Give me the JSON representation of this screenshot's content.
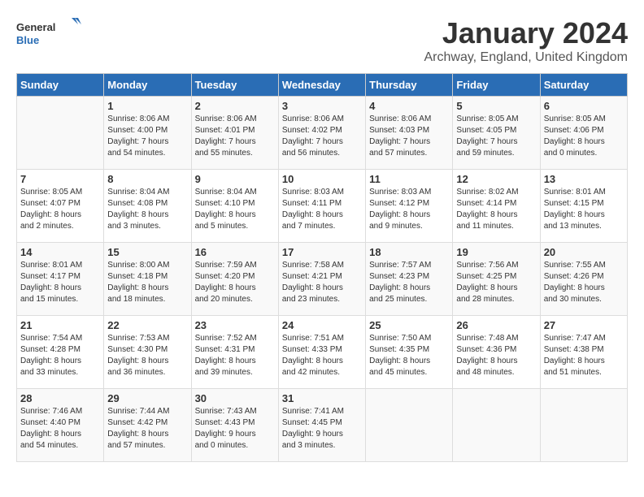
{
  "header": {
    "logo_general": "General",
    "logo_blue": "Blue",
    "month_year": "January 2024",
    "location": "Archway, England, United Kingdom"
  },
  "columns": [
    "Sunday",
    "Monday",
    "Tuesday",
    "Wednesday",
    "Thursday",
    "Friday",
    "Saturday"
  ],
  "weeks": [
    [
      {
        "day": "",
        "info": ""
      },
      {
        "day": "1",
        "info": "Sunrise: 8:06 AM\nSunset: 4:00 PM\nDaylight: 7 hours\nand 54 minutes."
      },
      {
        "day": "2",
        "info": "Sunrise: 8:06 AM\nSunset: 4:01 PM\nDaylight: 7 hours\nand 55 minutes."
      },
      {
        "day": "3",
        "info": "Sunrise: 8:06 AM\nSunset: 4:02 PM\nDaylight: 7 hours\nand 56 minutes."
      },
      {
        "day": "4",
        "info": "Sunrise: 8:06 AM\nSunset: 4:03 PM\nDaylight: 7 hours\nand 57 minutes."
      },
      {
        "day": "5",
        "info": "Sunrise: 8:05 AM\nSunset: 4:05 PM\nDaylight: 7 hours\nand 59 minutes."
      },
      {
        "day": "6",
        "info": "Sunrise: 8:05 AM\nSunset: 4:06 PM\nDaylight: 8 hours\nand 0 minutes."
      }
    ],
    [
      {
        "day": "7",
        "info": "Sunrise: 8:05 AM\nSunset: 4:07 PM\nDaylight: 8 hours\nand 2 minutes."
      },
      {
        "day": "8",
        "info": "Sunrise: 8:04 AM\nSunset: 4:08 PM\nDaylight: 8 hours\nand 3 minutes."
      },
      {
        "day": "9",
        "info": "Sunrise: 8:04 AM\nSunset: 4:10 PM\nDaylight: 8 hours\nand 5 minutes."
      },
      {
        "day": "10",
        "info": "Sunrise: 8:03 AM\nSunset: 4:11 PM\nDaylight: 8 hours\nand 7 minutes."
      },
      {
        "day": "11",
        "info": "Sunrise: 8:03 AM\nSunset: 4:12 PM\nDaylight: 8 hours\nand 9 minutes."
      },
      {
        "day": "12",
        "info": "Sunrise: 8:02 AM\nSunset: 4:14 PM\nDaylight: 8 hours\nand 11 minutes."
      },
      {
        "day": "13",
        "info": "Sunrise: 8:01 AM\nSunset: 4:15 PM\nDaylight: 8 hours\nand 13 minutes."
      }
    ],
    [
      {
        "day": "14",
        "info": "Sunrise: 8:01 AM\nSunset: 4:17 PM\nDaylight: 8 hours\nand 15 minutes."
      },
      {
        "day": "15",
        "info": "Sunrise: 8:00 AM\nSunset: 4:18 PM\nDaylight: 8 hours\nand 18 minutes."
      },
      {
        "day": "16",
        "info": "Sunrise: 7:59 AM\nSunset: 4:20 PM\nDaylight: 8 hours\nand 20 minutes."
      },
      {
        "day": "17",
        "info": "Sunrise: 7:58 AM\nSunset: 4:21 PM\nDaylight: 8 hours\nand 23 minutes."
      },
      {
        "day": "18",
        "info": "Sunrise: 7:57 AM\nSunset: 4:23 PM\nDaylight: 8 hours\nand 25 minutes."
      },
      {
        "day": "19",
        "info": "Sunrise: 7:56 AM\nSunset: 4:25 PM\nDaylight: 8 hours\nand 28 minutes."
      },
      {
        "day": "20",
        "info": "Sunrise: 7:55 AM\nSunset: 4:26 PM\nDaylight: 8 hours\nand 30 minutes."
      }
    ],
    [
      {
        "day": "21",
        "info": "Sunrise: 7:54 AM\nSunset: 4:28 PM\nDaylight: 8 hours\nand 33 minutes."
      },
      {
        "day": "22",
        "info": "Sunrise: 7:53 AM\nSunset: 4:30 PM\nDaylight: 8 hours\nand 36 minutes."
      },
      {
        "day": "23",
        "info": "Sunrise: 7:52 AM\nSunset: 4:31 PM\nDaylight: 8 hours\nand 39 minutes."
      },
      {
        "day": "24",
        "info": "Sunrise: 7:51 AM\nSunset: 4:33 PM\nDaylight: 8 hours\nand 42 minutes."
      },
      {
        "day": "25",
        "info": "Sunrise: 7:50 AM\nSunset: 4:35 PM\nDaylight: 8 hours\nand 45 minutes."
      },
      {
        "day": "26",
        "info": "Sunrise: 7:48 AM\nSunset: 4:36 PM\nDaylight: 8 hours\nand 48 minutes."
      },
      {
        "day": "27",
        "info": "Sunrise: 7:47 AM\nSunset: 4:38 PM\nDaylight: 8 hours\nand 51 minutes."
      }
    ],
    [
      {
        "day": "28",
        "info": "Sunrise: 7:46 AM\nSunset: 4:40 PM\nDaylight: 8 hours\nand 54 minutes."
      },
      {
        "day": "29",
        "info": "Sunrise: 7:44 AM\nSunset: 4:42 PM\nDaylight: 8 hours\nand 57 minutes."
      },
      {
        "day": "30",
        "info": "Sunrise: 7:43 AM\nSunset: 4:43 PM\nDaylight: 9 hours\nand 0 minutes."
      },
      {
        "day": "31",
        "info": "Sunrise: 7:41 AM\nSunset: 4:45 PM\nDaylight: 9 hours\nand 3 minutes."
      },
      {
        "day": "",
        "info": ""
      },
      {
        "day": "",
        "info": ""
      },
      {
        "day": "",
        "info": ""
      }
    ]
  ]
}
